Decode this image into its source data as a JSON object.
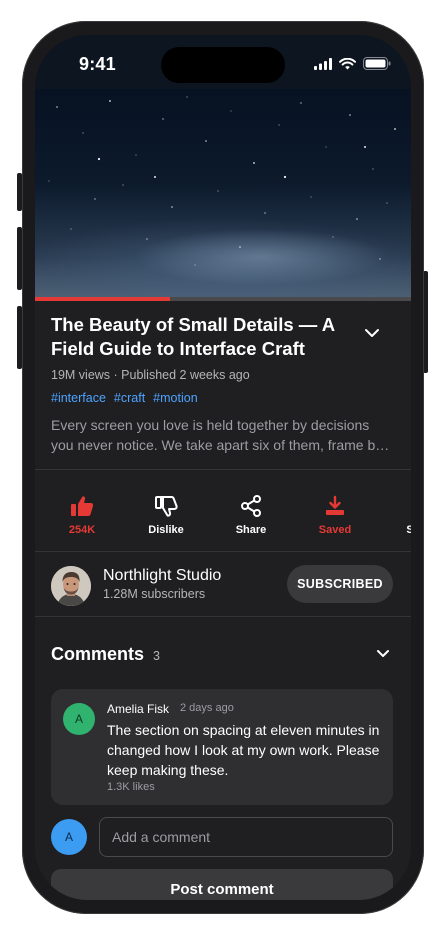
{
  "status_bar": {
    "time": "9:41",
    "icons": [
      "cellular-icon",
      "wifi-icon",
      "battery-icon"
    ]
  },
  "video": {
    "progress_fraction": 0.36
  },
  "video_meta": {
    "title": "The Beauty of Small Details — A Field Guide to Interface Craft",
    "stats": "19M views · Published 2 weeks ago",
    "tags": [
      "#interface",
      "#craft",
      "#motion"
    ],
    "description": "Every screen you love is held together by decisions you never notice. We take apart six of them, frame by frame."
  },
  "actions": [
    {
      "name": "like",
      "label": "254K",
      "icon": "thumbs-up-icon",
      "active": true
    },
    {
      "name": "dislike",
      "label": "Dislike",
      "icon": "thumbs-down-icon",
      "active": false
    },
    {
      "name": "share",
      "label": "Share",
      "icon": "share-icon",
      "active": false
    },
    {
      "name": "save",
      "label": "Saved",
      "icon": "download-icon",
      "active": true
    },
    {
      "name": "overflow",
      "label": "S",
      "icon": "",
      "active": false
    }
  ],
  "channel": {
    "name": "Northlight Studio",
    "subscribers": "1.28M subscribers",
    "subscribe_label": "SUBSCRIBED"
  },
  "comments": {
    "title": "Comments",
    "count": "3",
    "items": [
      {
        "avatar_initial": "A",
        "author": "Amelia Fisk",
        "time": "2 days ago",
        "text": "The section on spacing at eleven minutes in changed how I look at my own work. Please keep making these.",
        "likes": "1.3K likes"
      }
    ],
    "composer": {
      "avatar_initial": "A",
      "placeholder": "Add a comment",
      "post_label": "Post comment"
    }
  },
  "colors": {
    "accent": "#e53935",
    "link": "#4da3ff",
    "background": "#1f1f21"
  }
}
